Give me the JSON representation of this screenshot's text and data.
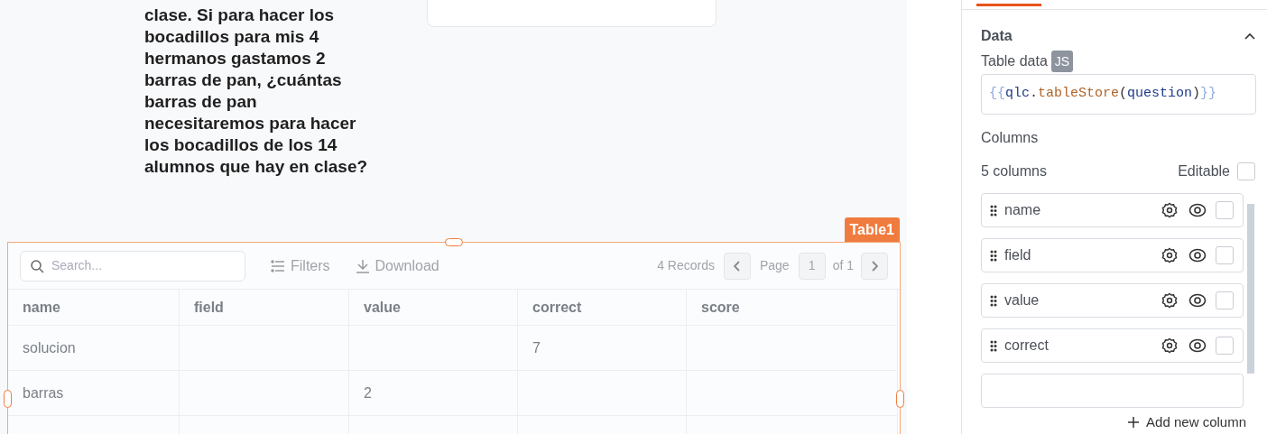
{
  "question_text": "clase. Si para hacer los bocadillos para mis 4 hermanos gastamos 2 barras de pan, ¿cuántas barras de pan necesitaremos para hacer los bocadillos de los 14 alumnos que hay en clase?",
  "table_widget": {
    "label": "Table1",
    "search": {
      "placeholder": "Search..."
    },
    "filters": "Filters",
    "download": "Download",
    "records": "4 Records",
    "page_label": "Page",
    "page": "1",
    "of_pages": "of 1",
    "columns": [
      "name",
      "field",
      "value",
      "correct",
      "score"
    ],
    "rows": [
      [
        "solucion",
        "",
        "",
        "7",
        ""
      ],
      [
        "barras",
        "",
        "2",
        "",
        ""
      ]
    ]
  },
  "panel": {
    "section": "Data",
    "expanded": true,
    "table_data_label": "Table data",
    "js_badge": "JS",
    "code": [
      {
        "text": "{{",
        "kind": "brace"
      },
      {
        "text": "qlc",
        "kind": "ident"
      },
      {
        "text": ".",
        "kind": "punct"
      },
      {
        "text": "tableStore",
        "kind": "method"
      },
      {
        "text": "(",
        "kind": "punct"
      },
      {
        "text": "question",
        "kind": "ident"
      },
      {
        "text": ")",
        "kind": "punct"
      },
      {
        "text": "}}",
        "kind": "brace"
      }
    ],
    "columns_label": "Columns",
    "columns_count": "5 columns",
    "editable_label": "Editable",
    "editable": false,
    "columns": [
      {
        "name": "name",
        "checked": false
      },
      {
        "name": "field",
        "checked": false
      },
      {
        "name": "value",
        "checked": false
      },
      {
        "name": "correct",
        "checked": false
      }
    ],
    "add_column": "Add new column"
  }
}
